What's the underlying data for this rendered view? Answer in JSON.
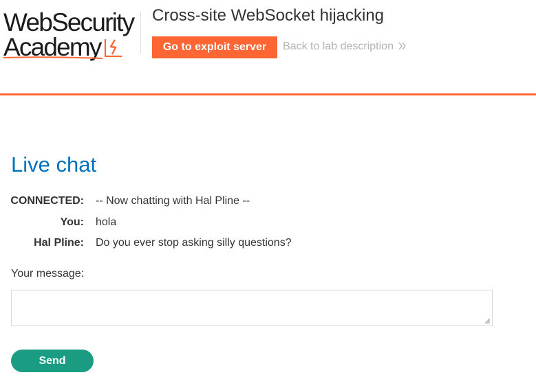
{
  "header": {
    "logo_line1": "WebSecurity",
    "logo_line2": "Academy",
    "lab_title": "Cross-site WebSocket hijacking",
    "exploit_button": "Go to exploit server",
    "back_link": "Back to lab description"
  },
  "chat": {
    "title": "Live chat",
    "messages": [
      {
        "who": "CONNECTED:",
        "text": "-- Now chatting with Hal Pline --"
      },
      {
        "who": "You:",
        "text": "hola"
      },
      {
        "who": "Hal Pline:",
        "text": "Do you ever stop asking silly questions?"
      }
    ],
    "message_label": "Your message:",
    "message_value": "",
    "send_label": "Send"
  },
  "colors": {
    "accent": "#ff6633",
    "title_blue": "#0071bc",
    "send_green": "#1a9c83"
  },
  "icons": {
    "logo_bolt": "lightning-bolt-icon",
    "back_chevron": "double-chevron-right-icon"
  }
}
